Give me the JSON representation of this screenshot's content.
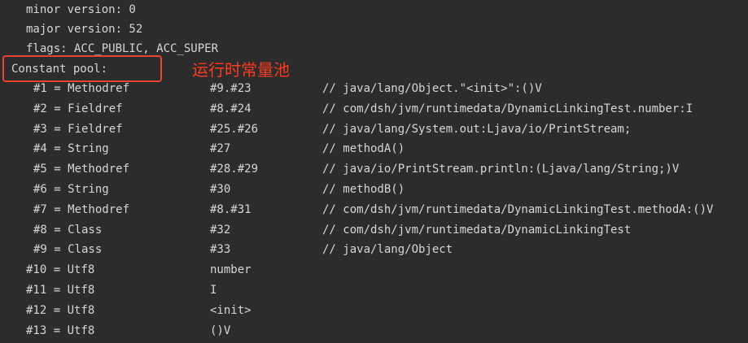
{
  "header": {
    "minor_version": "minor version: 0",
    "major_version": "major version: 52",
    "flags": "flags: ACC_PUBLIC, ACC_SUPER"
  },
  "constant_pool": {
    "label": "Constant pool:",
    "annotation": "运行时常量池",
    "highlight_color": "#e8452c",
    "entries": [
      {
        "index": "#1 = Methodref",
        "ref": "#9.#23",
        "comment": "// java/lang/Object.\"<init>\":()V"
      },
      {
        "index": "#2 = Fieldref",
        "ref": "#8.#24",
        "comment": "// com/dsh/jvm/runtimedata/DynamicLinkingTest.number:I"
      },
      {
        "index": "#3 = Fieldref",
        "ref": "#25.#26",
        "comment": "// java/lang/System.out:Ljava/io/PrintStream;"
      },
      {
        "index": "#4 = String",
        "ref": "#27",
        "comment": "// methodA()"
      },
      {
        "index": "#5 = Methodref",
        "ref": "#28.#29",
        "comment": "// java/io/PrintStream.println:(Ljava/lang/String;)V"
      },
      {
        "index": "#6 = String",
        "ref": "#30",
        "comment": "// methodB()"
      },
      {
        "index": "#7 = Methodref",
        "ref": "#8.#31",
        "comment": "// com/dsh/jvm/runtimedata/DynamicLinkingTest.methodA:()V"
      },
      {
        "index": "#8 = Class",
        "ref": "#32",
        "comment": "// com/dsh/jvm/runtimedata/DynamicLinkingTest"
      },
      {
        "index": "#9 = Class",
        "ref": "#33",
        "comment": "// java/lang/Object"
      },
      {
        "index": "#10 = Utf8",
        "ref": "number",
        "comment": ""
      },
      {
        "index": "#11 = Utf8",
        "ref": "I",
        "comment": ""
      },
      {
        "index": "#12 = Utf8",
        "ref": "<init>",
        "comment": ""
      },
      {
        "index": "#13 = Utf8",
        "ref": "()V",
        "comment": ""
      }
    ]
  }
}
